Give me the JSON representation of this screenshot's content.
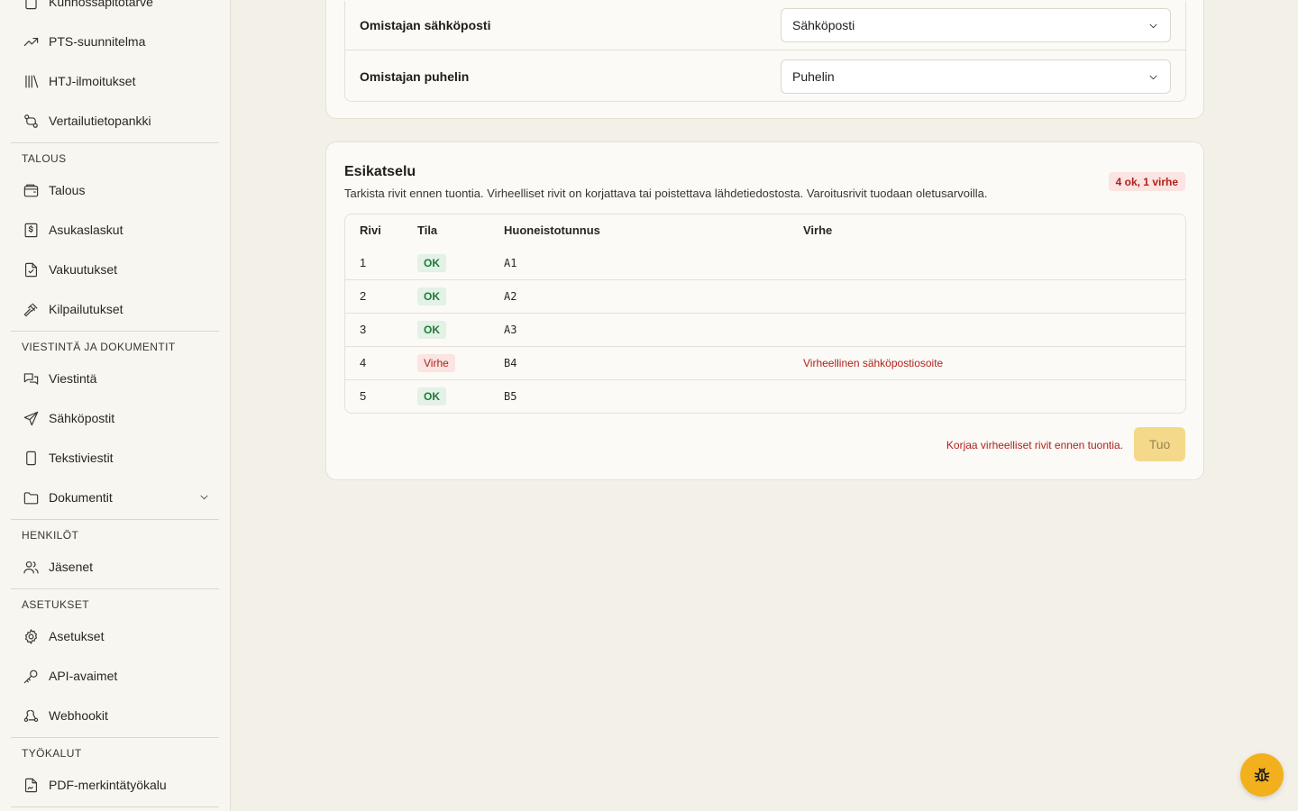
{
  "sidebar": {
    "items_top": [
      {
        "label": "Kunnossapitotarve",
        "icon": "clipboard-icon"
      },
      {
        "label": "PTS-suunnitelma",
        "icon": "trending-up-icon"
      },
      {
        "label": "HTJ-ilmoitukset",
        "icon": "library-icon"
      },
      {
        "label": "Vertailutietopankki",
        "icon": "compare-icon"
      }
    ],
    "sections": [
      {
        "title": "TALOUS",
        "items": [
          {
            "label": "Talous",
            "icon": "wallet-icon"
          },
          {
            "label": "Asukaslaskut",
            "icon": "invoice-icon"
          },
          {
            "label": "Vakuutukset",
            "icon": "insurance-file-icon"
          },
          {
            "label": "Kilpailutukset",
            "icon": "gavel-icon"
          }
        ]
      },
      {
        "title": "VIESTINTÄ JA DOKUMENTIT",
        "items": [
          {
            "label": "Viestintä",
            "icon": "chat-icon"
          },
          {
            "label": "Sähköpostit",
            "icon": "send-icon"
          },
          {
            "label": "Tekstiviestit",
            "icon": "phone-icon"
          },
          {
            "label": "Dokumentit",
            "icon": "folder-icon"
          }
        ]
      },
      {
        "title": "HENKILÖT",
        "items": [
          {
            "label": "Jäsenet",
            "icon": "users-icon"
          }
        ]
      },
      {
        "title": "ASETUKSET",
        "items": [
          {
            "label": "Asetukset",
            "icon": "gear-icon"
          },
          {
            "label": "API-avaimet",
            "icon": "key-icon"
          },
          {
            "label": "Webhookit",
            "icon": "webhook-icon"
          }
        ]
      },
      {
        "title": "TYÖKALUT",
        "items": [
          {
            "label": "PDF-merkintätyökalu",
            "icon": "file-signature-icon"
          }
        ]
      }
    ]
  },
  "owner_mapping": {
    "rows": [
      {
        "label": "Omistajan sähköposti",
        "selected": "Sähköposti"
      },
      {
        "label": "Omistajan puhelin",
        "selected": "Puhelin"
      }
    ]
  },
  "preview": {
    "title": "Esikatselu",
    "description": "Tarkista rivit ennen tuontia. Virheelliset rivit on korjattava tai poistettava lähdetiedostosta. Varoitusrivit tuodaan oletusarvoilla.",
    "summary": "4 ok, 1 virhe",
    "columns": [
      "Rivi",
      "Tila",
      "Huoneistotunnus",
      "Virhe"
    ],
    "rows": [
      {
        "row": "1",
        "status": "OK",
        "unit": "A1",
        "error": ""
      },
      {
        "row": "2",
        "status": "OK",
        "unit": "A2",
        "error": ""
      },
      {
        "row": "3",
        "status": "OK",
        "unit": "A3",
        "error": ""
      },
      {
        "row": "4",
        "status": "Virhe",
        "unit": "B4",
        "error": "Virheellinen sähköpostiosoite"
      },
      {
        "row": "5",
        "status": "OK",
        "unit": "B5",
        "error": ""
      }
    ],
    "footer_message": "Korjaa virheelliset rivit ennen tuontia.",
    "import_label": "Tuo"
  },
  "colors": {
    "accent": "#f2b01c",
    "ok": "#1f7a3b",
    "error": "#b0221c"
  }
}
